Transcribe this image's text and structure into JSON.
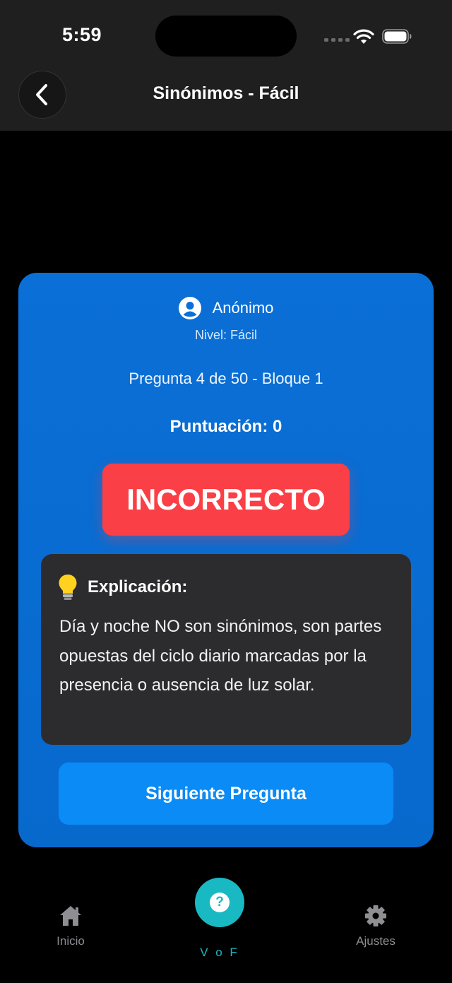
{
  "status_bar": {
    "time": "5:59"
  },
  "nav": {
    "title": "Sinónimos - Fácil"
  },
  "card": {
    "user_name": "Anónimo",
    "level": "Nivel: Fácil",
    "question_progress": "Pregunta 4 de 50 - Bloque 1",
    "score": "Puntuación: 0",
    "result": "INCORRECTO",
    "explanation": {
      "title": "Explicación:",
      "body": "Día y noche NO son sinónimos, son partes opuestas del ciclo diario marcadas por la presencia o ausencia de luz solar."
    },
    "next_button": "Siguiente Pregunta"
  },
  "tabbar": {
    "home_label": "Inicio",
    "center_label": "V o F",
    "settings_label": "Ajustes"
  },
  "colors": {
    "card": "#0a6fd6",
    "incorrect": "#fa4046",
    "next_button": "#0a8bf5",
    "accent": "#19b9c4"
  }
}
